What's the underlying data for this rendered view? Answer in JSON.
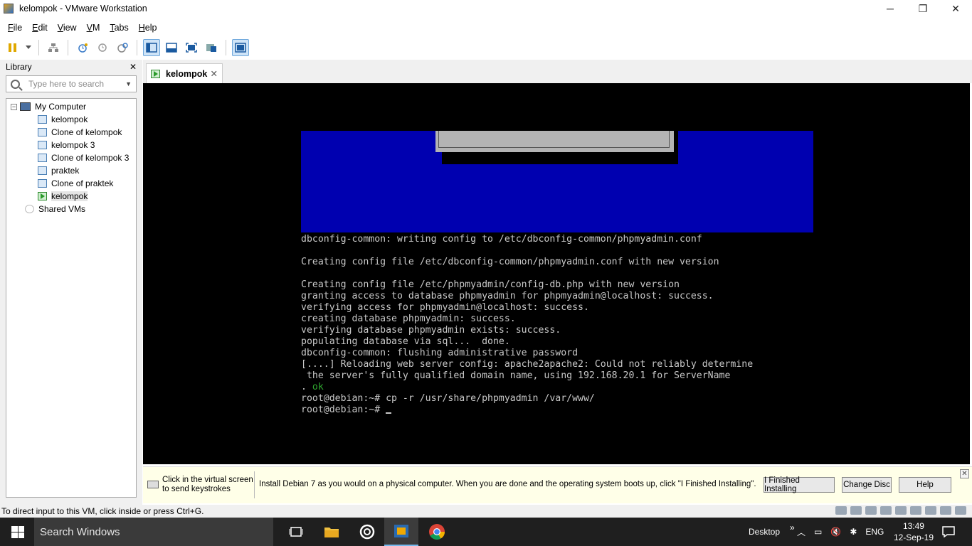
{
  "window": {
    "title": "kelompok - VMware Workstation",
    "minimize": "─",
    "restore": "❐",
    "close": "✕"
  },
  "menu": [
    "File",
    "Edit",
    "View",
    "VM",
    "Tabs",
    "Help"
  ],
  "library": {
    "title": "Library",
    "close": "✕",
    "search_placeholder": "Type here to search",
    "root_label": "My Computer",
    "items": [
      "kelompok",
      "Clone of kelompok",
      "kelompok 3",
      "Clone of kelompok 3",
      "praktek",
      "Clone of praktek",
      "kelompok"
    ],
    "selected_index": 6,
    "shared": "Shared VMs"
  },
  "tab": {
    "label": "kelompok",
    "close": "✕"
  },
  "console": {
    "lines": [
      "dbconfig-common: writing config to /etc/dbconfig-common/phpmyadmin.conf",
      "",
      "Creating config file /etc/dbconfig-common/phpmyadmin.conf with new version",
      "",
      "Creating config file /etc/phpmyadmin/config-db.php with new version",
      "granting access to database phpmyadmin for phpmyadmin@localhost: success.",
      "verifying access for phpmyadmin@localhost: success.",
      "creating database phpmyadmin: success.",
      "verifying database phpmyadmin exists: success.",
      "populating database via sql...  done.",
      "dbconfig-common: flushing administrative password",
      "[....] Reloading web server config: apache2apache2: Could not reliably determine",
      " the server's fully qualified domain name, using 192.168.20.1 for ServerName"
    ],
    "ok_prefix": ". ",
    "ok_text": "ok",
    "cmd_line": "root@debian:~# cp -r /usr/share/phpmyadmin /var/www/",
    "prompt": "root@debian:~# "
  },
  "infobar": {
    "hint": "Click in the virtual screen to send keystrokes",
    "message": "Install Debian 7 as you would on a physical computer. When you are done and the operating system boots up, click \"I Finished Installing\".",
    "btn_finished": "I Finished Installing",
    "btn_change_disc": "Change Disc",
    "btn_help": "Help",
    "close": "✕"
  },
  "status": {
    "text": "To direct input to this VM, click inside or press Ctrl+G."
  },
  "taskbar": {
    "search": "Search Windows",
    "desktop": "Desktop",
    "chevron": "»",
    "lang": "ENG",
    "time": "13:49",
    "date": "12-Sep-19"
  }
}
